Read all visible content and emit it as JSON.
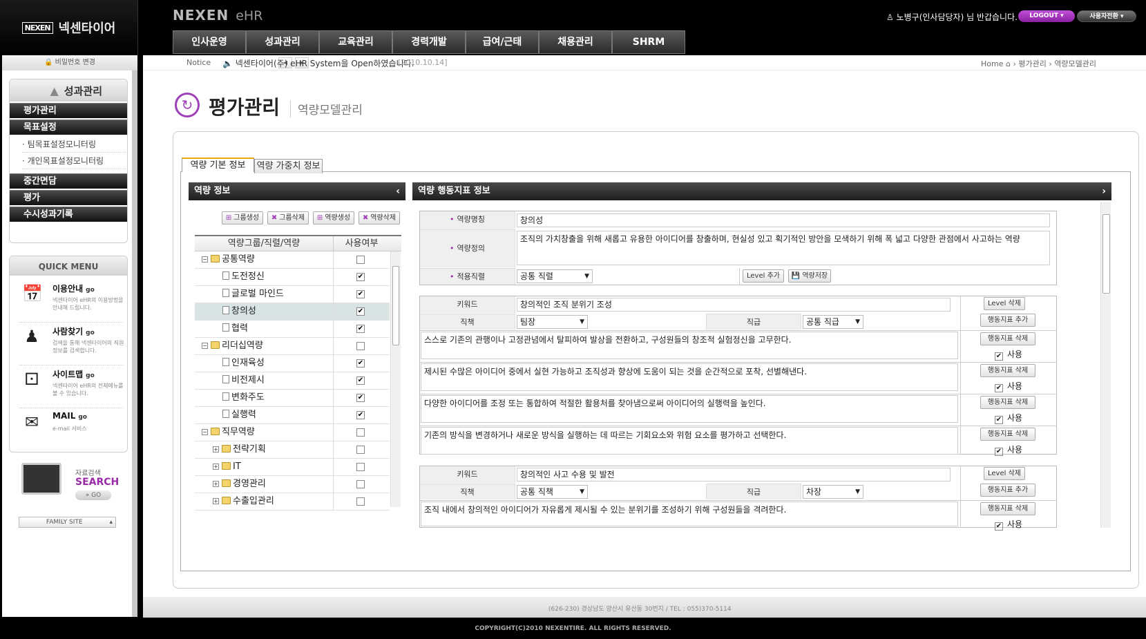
{
  "header": {
    "logo_mark": "NEXEN",
    "logo_name": "넥센타이어",
    "brand": "NEXEN",
    "brand_sub": "eHR",
    "user_text": "노병구(인사담당자) 님 반갑습니다.",
    "logout_label": "LOGOUT",
    "switch_label": "사용자전환",
    "nav": [
      "인사운영",
      "성과관리",
      "교육관리",
      "경력개발",
      "급여/근태",
      "채용관리",
      "SHRM"
    ]
  },
  "sidebar": {
    "password_change": "비밀번호 변경",
    "section_title": "성과관리",
    "items": [
      {
        "label": "평가관리"
      },
      {
        "label": "목표설정"
      },
      {
        "label": "· 팀목표설정모니터링"
      },
      {
        "label": "· 개인목표설정모니터링"
      },
      {
        "label": "중간면담"
      },
      {
        "label": "평가"
      },
      {
        "label": "수시성과기록"
      }
    ],
    "quick_menu_title": "QUICK MENU",
    "quick": [
      {
        "title": "이용안내",
        "go": "go",
        "desc": "넥센타이어 eHR의 이용방법을 안내해 드립니다.",
        "icon": "calendar-icon"
      },
      {
        "title": "사람찾기",
        "go": "go",
        "desc": "검색을 통해 넥센타이어의 직원정보를 검색합니다.",
        "icon": "people-icon"
      },
      {
        "title": "사이트맵",
        "go": "go",
        "desc": "넥센타이어 eHR의 전체메뉴를 볼 수 있습니다.",
        "icon": "cube-icon"
      },
      {
        "title": "MAIL",
        "go": "go",
        "desc": "e-mail 서비스",
        "icon": "mail-icon"
      }
    ],
    "search_label1": "자료검색",
    "search_label2": "SEARCH",
    "search_go": "» GO",
    "family_site": "FAMILY SITE"
  },
  "notice": {
    "label": "Notice",
    "text": "넥센타이어(주) eHR System을 Open하였습니다.",
    "date": "[2010.10.14]"
  },
  "breadcrumb": {
    "home": "Home",
    "level1": "평가관리",
    "level2": "역량모델관리"
  },
  "page": {
    "title": "평가관리",
    "subtitle": "역량모델관리"
  },
  "tabs": [
    "역량 기본 정보",
    "역량 가중치 정보"
  ],
  "left_panel": {
    "title": "역량 정보",
    "buttons": [
      "그룹생성",
      "그룹삭제",
      "역량생성",
      "역량삭제"
    ],
    "col_name": "역량그룹/직렬/역량",
    "col_use": "사용여부",
    "tree": [
      {
        "label": "공통역량",
        "type": "group",
        "expanded": true,
        "checked": false
      },
      {
        "label": "도전정신",
        "type": "item",
        "checked": true
      },
      {
        "label": "글로벌 마인드",
        "type": "item",
        "checked": true
      },
      {
        "label": "창의성",
        "type": "item",
        "checked": true,
        "selected": true
      },
      {
        "label": "협력",
        "type": "item",
        "checked": true
      },
      {
        "label": "리더십역량",
        "type": "group",
        "expanded": true,
        "checked": false
      },
      {
        "label": "인재육성",
        "type": "item",
        "checked": true
      },
      {
        "label": "비전제시",
        "type": "item",
        "checked": true
      },
      {
        "label": "변화주도",
        "type": "item",
        "checked": true
      },
      {
        "label": "실행력",
        "type": "item",
        "checked": true
      },
      {
        "label": "직무역량",
        "type": "group",
        "expanded": true,
        "checked": false
      },
      {
        "label": "전략기획",
        "type": "subgroup",
        "checked": false
      },
      {
        "label": "IT",
        "type": "subgroup",
        "checked": false
      },
      {
        "label": "경영관리",
        "type": "subgroup",
        "checked": false
      },
      {
        "label": "수출입관리",
        "type": "subgroup",
        "checked": false
      }
    ]
  },
  "right_panel": {
    "title": "역량 행동지표 정보",
    "name_label": "역량명칭",
    "name_value": "창의성",
    "def_label": "역량정의",
    "def_value": "조직의 가치창출을 위해 새롭고 유용한 아이디어를 창출하며, 현실성 있고 획기적인 방안을 모색하기 위해 폭 넓고 다양한 관점에서 사고하는 역량",
    "series_label": "적용직렬",
    "series_value": "공통 직렬",
    "level_add": "Level 추가",
    "save": "역량저장",
    "keyword_label": "키워드",
    "duty_label": "직책",
    "rank_label": "직급",
    "level_delete": "Level 삭제",
    "indicator_add": "행동지표 추가",
    "indicator_delete": "행동지표 삭제",
    "use_label": "사용",
    "levels": [
      {
        "keyword": "창의적인 조직 분위기 조성",
        "duty": "팀장",
        "rank": "공통 직급",
        "indicators": [
          "스스로 기존의 관행이나 고정관념에서 탈피하여 발상을 전환하고, 구성원들의 창조적 실험정신을 고무한다.",
          "제시된 수많은 아이디어 중에서 실현 가능하고 조직성과 향상에 도움이 되는 것을 순간적으로 포착, 선별해낸다.",
          "다양한 아이디어를 조정 또는 통합하여 적절한 활용처를 찾아냄으로써 아이디어의 실행력을 높인다.",
          "기존의 방식을 변경하거나 새로운 방식을 실행하는 데 따르는 기회요소와 위험 요소를 평가하고 선택한다."
        ]
      },
      {
        "keyword": "창의적인 사고 수용 및 발전",
        "duty": "공통 직책",
        "rank": "차장",
        "indicators": [
          "조직 내에서 창의적인 아이디어가 자유롭게 제시될 수 있는 분위기를 조성하기 위해 구성원들을 격려한다."
        ]
      }
    ]
  },
  "footer": {
    "address": "(626-230) 경상남도 양산시 유산동 30번지   /   TEL : 055)370-5114",
    "copyright": "COPYRIGHT(C)2010 NEXENTIRE. ALL RIGHTS RESERVED."
  }
}
